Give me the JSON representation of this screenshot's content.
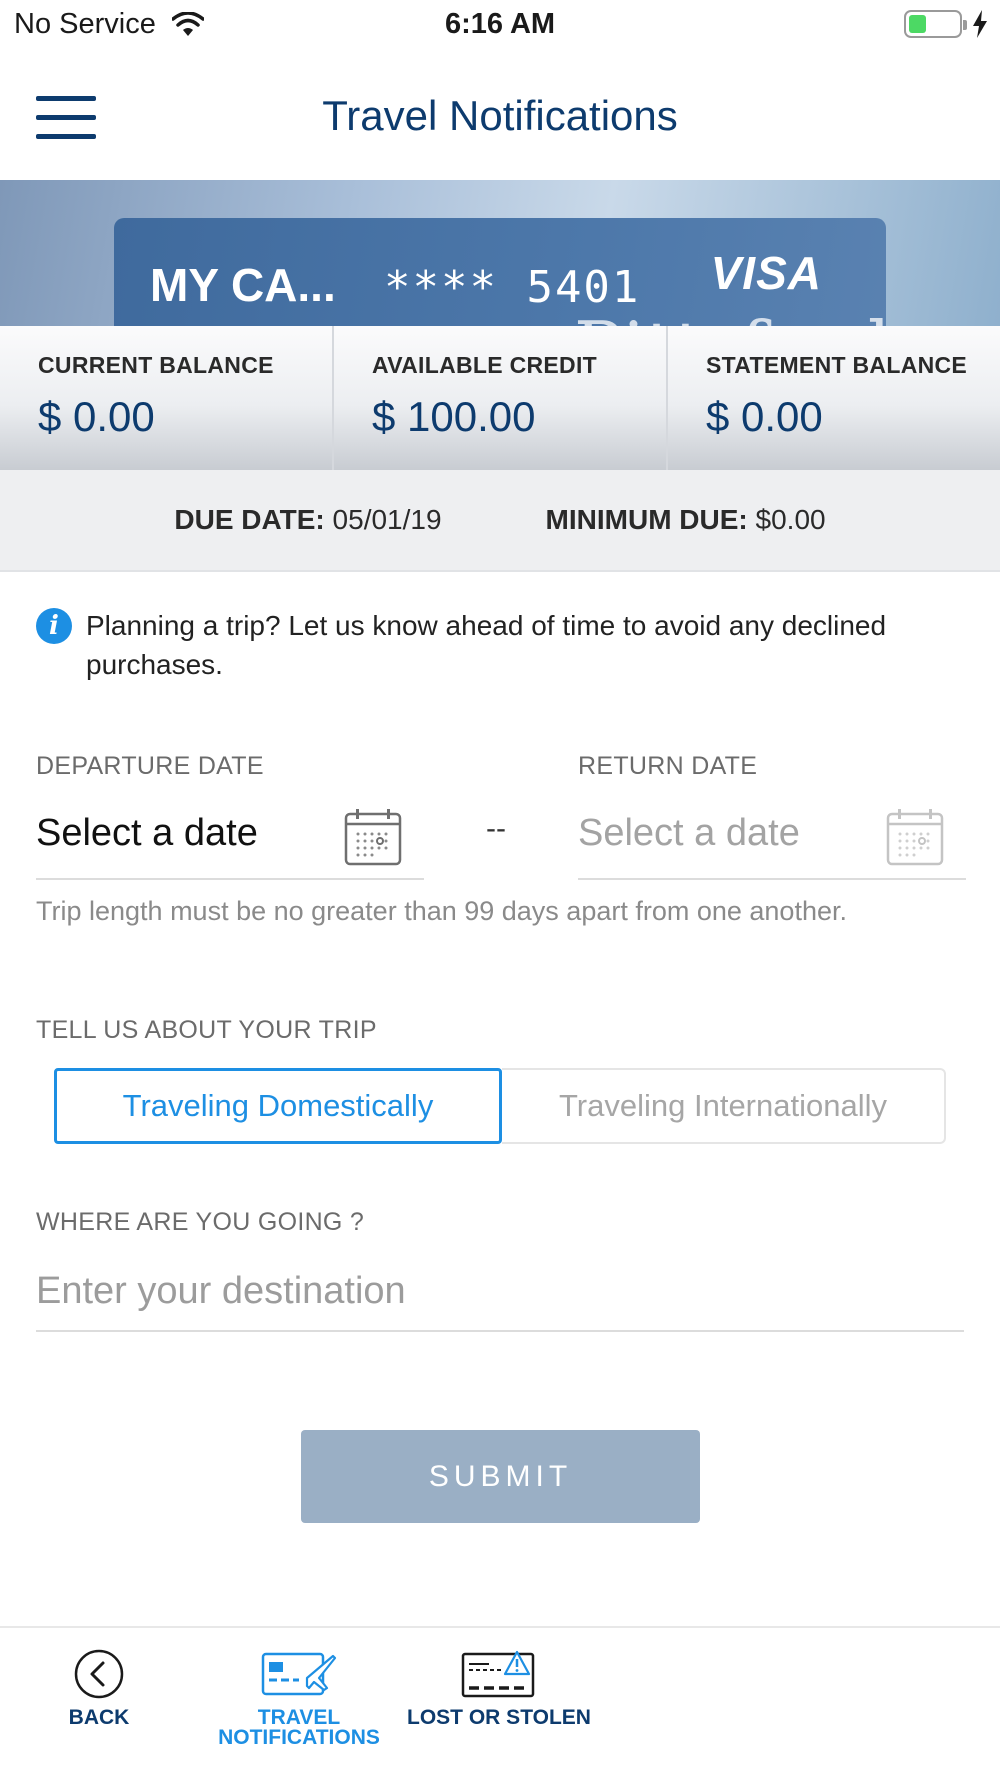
{
  "status_bar": {
    "carrier": "No Service",
    "time": "6:16 AM",
    "battery_level": 0.35,
    "battery_color": "#4cd964"
  },
  "header": {
    "title": "Travel Notifications",
    "menu_icon": "hamburger-menu-icon"
  },
  "card": {
    "name": "MY CA...",
    "masked_number": "**** 5401",
    "brand": "VISA",
    "background_script": "Pittsford"
  },
  "balances": [
    {
      "label": "CURRENT BALANCE",
      "value": "$ 0.00"
    },
    {
      "label": "AVAILABLE CREDIT",
      "value": "$ 100.00"
    },
    {
      "label": "STATEMENT BALANCE",
      "value": "$ 0.00"
    }
  ],
  "due": {
    "due_date_label": "DUE DATE:",
    "due_date_value": "05/01/19",
    "minimum_due_label": "MINIMUM DUE:",
    "minimum_due_value": "$0.00"
  },
  "info": {
    "icon": "info-icon",
    "text": "Planning a trip? Let us know ahead of time to avoid any declined purchases."
  },
  "dates": {
    "departure_label": "DEPARTURE DATE",
    "departure_value": "Select a date",
    "separator": "--",
    "return_label": "RETURN DATE",
    "return_placeholder": "Select a date",
    "hint": "Trip length must be no greater than 99 days apart from one another."
  },
  "trip": {
    "label": "TELL US ABOUT YOUR TRIP",
    "options": [
      "Traveling Domestically",
      "Traveling Internationally"
    ],
    "selected": "Traveling Domestically",
    "accent_color": "#1d8fe3"
  },
  "destination": {
    "label": "WHERE ARE YOU GOING ?",
    "value": "",
    "placeholder": "Enter your destination"
  },
  "submit": {
    "label": "SUBMIT",
    "enabled": false
  },
  "bottom_nav": {
    "items": [
      {
        "label": "BACK",
        "icon": "back-arrow-circle-icon"
      },
      {
        "label": "TRAVEL NOTIFICATIONS",
        "icon": "card-airplane-icon",
        "active": true
      },
      {
        "label": "LOST OR STOLEN",
        "icon": "card-warning-icon"
      }
    ],
    "brand_color": "#0d3b6e"
  }
}
